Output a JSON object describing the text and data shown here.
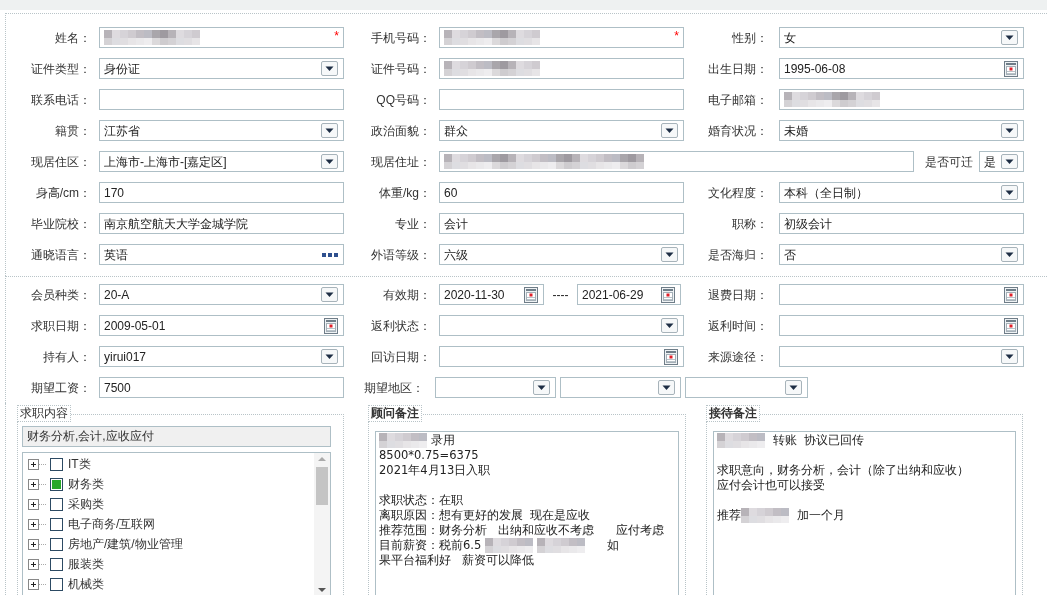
{
  "section_1": {
    "rows": [
      {
        "cells": [
          {
            "label": "姓名：",
            "kind": "text",
            "redacted": true,
            "required_mark": "*"
          },
          {
            "label": "手机号码：",
            "kind": "text",
            "redacted": true,
            "required_mark": "*"
          },
          {
            "label": "性别：",
            "kind": "select",
            "value": "女"
          }
        ]
      },
      {
        "cells": [
          {
            "label": "证件类型：",
            "kind": "select",
            "value": "身份证"
          },
          {
            "label": "证件号码：",
            "kind": "text",
            "redacted": true
          },
          {
            "label": "出生日期：",
            "kind": "date",
            "value": "1995-06-08"
          }
        ]
      },
      {
        "cells": [
          {
            "label": "联系电话：",
            "kind": "text"
          },
          {
            "label": "QQ号码：",
            "kind": "text"
          },
          {
            "label": "电子邮箱：",
            "kind": "text",
            "redacted": true
          }
        ]
      },
      {
        "cells": [
          {
            "label": "籍贯：",
            "kind": "select",
            "value": "江苏省"
          },
          {
            "label": "政治面貌：",
            "kind": "select",
            "value": "群众"
          },
          {
            "label": "婚育状况：",
            "kind": "select",
            "value": "未婚"
          }
        ]
      },
      {
        "cells": [
          {
            "label": "现居住区：",
            "kind": "select",
            "value": " 上海市-上海市-[嘉定区]"
          },
          {
            "label": "现居住址：",
            "kind": "wide_text",
            "redacted": true
          },
          {
            "label": "是否可迁",
            "kind": "short_select",
            "value": "是"
          }
        ]
      },
      {
        "cells": [
          {
            "label": "身高/cm：",
            "kind": "text",
            "value": "170"
          },
          {
            "label": "体重/kg：",
            "kind": "text",
            "value": "60"
          },
          {
            "label": "文化程度：",
            "kind": "select",
            "value": "本科（全日制）"
          }
        ]
      },
      {
        "cells": [
          {
            "label": "毕业院校：",
            "kind": "text",
            "value": "南京航空航天大学金城学院"
          },
          {
            "label": "专业：",
            "kind": "text",
            "value": "会计"
          },
          {
            "label": "职称：",
            "kind": "text",
            "value": "初级会计"
          }
        ]
      },
      {
        "cells": [
          {
            "label": "通晓语言：",
            "kind": "lookup",
            "value": "英语"
          },
          {
            "label": "外语等级：",
            "kind": "select",
            "value": "六级"
          },
          {
            "label": "是否海归：",
            "kind": "select",
            "value": "否"
          }
        ]
      }
    ]
  },
  "section_2": {
    "rows": [
      {
        "cells": [
          {
            "label": "会员种类：",
            "kind": "select",
            "value": "20-A"
          },
          {
            "label": "有效期：",
            "kind": "date_range",
            "value": "2020-11-30",
            "separator": "----",
            "value_2": "2021-06-29"
          },
          {
            "label": "退费日期：",
            "kind": "date"
          }
        ]
      },
      {
        "cells": [
          {
            "label": "求职日期：",
            "kind": "date",
            "value": "2009-05-01"
          },
          {
            "label": "返利状态：",
            "kind": "select"
          },
          {
            "label": "返利时间：",
            "kind": "date"
          }
        ]
      },
      {
        "cells": [
          {
            "label": "持有人：",
            "kind": "select",
            "value": "yirui017"
          },
          {
            "label": "回访日期：",
            "kind": "date"
          },
          {
            "label": "来源途径：",
            "kind": "select"
          }
        ]
      },
      {
        "cells": [
          {
            "label": "期望工资：",
            "kind": "text",
            "value": "7500"
          },
          {
            "label": "期望地区：",
            "kind": "triple_select"
          }
        ]
      }
    ]
  },
  "job_content": {
    "title": "求职内容",
    "summary": "财务分析,会计,应收应付",
    "tree": [
      {
        "label": "IT类",
        "checked": false,
        "expanded": false
      },
      {
        "label": "财务类",
        "checked": true,
        "expanded": false
      },
      {
        "label": "采购类",
        "checked": false,
        "expanded": false
      },
      {
        "label": "电子商务/互联网",
        "checked": false,
        "expanded": false
      },
      {
        "label": "房地产/建筑/物业管理",
        "checked": false,
        "expanded": false
      },
      {
        "label": "服装类",
        "checked": false,
        "expanded": false
      },
      {
        "label": "机械类",
        "checked": false,
        "expanded": false
      }
    ]
  },
  "notes": [
    {
      "title": "顾问备注",
      "lines": [
        {
          "kind": "text",
          "parts": [
            {
              "kind": "blur"
            },
            {
              "kind": "text",
              "text": "录用"
            }
          ]
        },
        {
          "kind": "text",
          "parts": [
            {
              "kind": "text",
              "text": "8500*0.75=6375"
            }
          ]
        },
        {
          "kind": "text",
          "parts": [
            {
              "kind": "text",
              "text": "2021年4月13日入职"
            }
          ]
        },
        {
          "kind": "blank"
        },
        {
          "kind": "text",
          "parts": [
            {
              "kind": "text",
              "text": "求职状态：在职"
            }
          ]
        },
        {
          "kind": "text",
          "parts": [
            {
              "kind": "text",
              "text": "离职原因：想有更好的发展  现在是应收"
            }
          ]
        },
        {
          "kind": "text",
          "parts": [
            {
              "kind": "text",
              "text": "推荐范围：财务分析   出纳和应收不考虑      应付考虑"
            }
          ]
        },
        {
          "kind": "text",
          "parts": [
            {
              "kind": "text",
              "text": "目前薪资：税前6.5 "
            },
            {
              "kind": "blur"
            },
            {
              "kind": "blur"
            },
            {
              "kind": "text",
              "text": "     如"
            }
          ]
        },
        {
          "kind": "text",
          "parts": [
            {
              "kind": "text",
              "text": "果平台福利好   薪资可以降低"
            }
          ]
        }
      ]
    },
    {
      "title": "接待备注",
      "lines": [
        {
          "kind": "text",
          "parts": [
            {
              "kind": "blur"
            },
            {
              "kind": "text",
              "text": " 转账  协议已回传"
            }
          ]
        },
        {
          "kind": "blank"
        },
        {
          "kind": "text",
          "parts": [
            {
              "kind": "text",
              "text": "求职意向，财务分析，会计（除了出纳和应收）"
            }
          ]
        },
        {
          "kind": "text",
          "parts": [
            {
              "kind": "text",
              "text": "应付会计也可以接受"
            }
          ]
        },
        {
          "kind": "blank"
        },
        {
          "kind": "text",
          "parts": [
            {
              "kind": "text",
              "text": "推荐"
            },
            {
              "kind": "blur"
            },
            {
              "kind": "text",
              "text": " 加一个月"
            }
          ]
        }
      ]
    }
  ]
}
